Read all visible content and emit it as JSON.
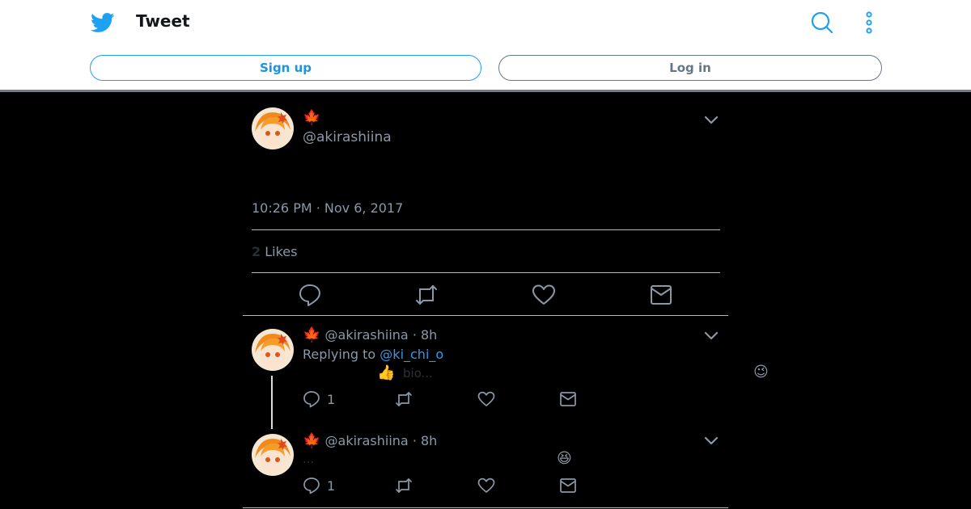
{
  "header": {
    "title": "Tweet",
    "signup_label": "Sign up",
    "login_label": "Log in"
  },
  "tweet": {
    "name_glyph": "🍁",
    "handle": "@akirashiina",
    "timestamp": "10:26 PM · Nov 6, 2017",
    "likes_count": "2",
    "likes_label": "Likes"
  },
  "replies": [
    {
      "name_glyph": "🍁",
      "meta": "@akirashiina · 8h",
      "replying_prefix": "Replying to ",
      "replying_mention": "@ki_chi_o",
      "body_emoji": "👍",
      "body_text": "bio...",
      "side_emoji": "😉",
      "reply_count": "1"
    },
    {
      "name_glyph": "🍁",
      "meta": "@akirashiina · 8h",
      "body_text": "...",
      "side_emoji": "😆",
      "reply_count": "1"
    }
  ],
  "colors": {
    "brand_blue": "#1da1f2",
    "background": "#000000",
    "text_secondary": "#8b98a5",
    "maple_red": "#d9302c"
  },
  "icons": [
    "twitter-bird-icon",
    "search-icon",
    "more-vertical-icon",
    "chevron-down-icon",
    "reply-icon",
    "retweet-icon",
    "like-icon",
    "share-mail-icon"
  ]
}
